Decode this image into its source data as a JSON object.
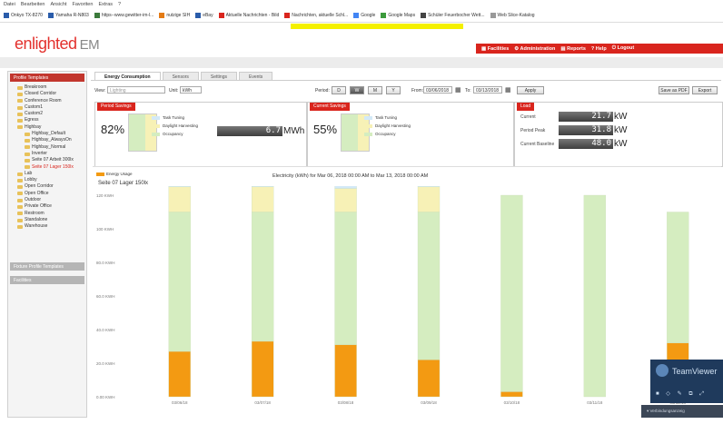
{
  "browser": {
    "menu": [
      "Datei",
      "Bearbeiten",
      "Ansicht",
      "Favoriten",
      "Extras",
      "?"
    ],
    "bookmarks": [
      {
        "label": "Onkyo TX-8270",
        "color": "#2a5caa"
      },
      {
        "label": "Yamaha R-N803",
        "color": "#2a5caa"
      },
      {
        "label": "https--www.gewitter-im-l...",
        "color": "#3b7a3b"
      },
      {
        "label": "nutzige SIH",
        "color": "#e47b15"
      },
      {
        "label": "eBay",
        "color": "#2a5caa"
      },
      {
        "label": "Aktuelle Nachrichten - Bild",
        "color": "#d9251d"
      },
      {
        "label": "Nachrichten, aktuelle Schl...",
        "color": "#d9251d"
      },
      {
        "label": "Google",
        "color": "#4285f4"
      },
      {
        "label": "Google Maps",
        "color": "#3b9a3b"
      },
      {
        "label": "Schüler Feuerbocher Wett...",
        "color": "#444444"
      },
      {
        "label": "Web Slice-Katalog",
        "color": "#999999"
      }
    ]
  },
  "app": {
    "logo_brand": "enlighted",
    "logo_suffix": "EM",
    "nav": [
      "Facilities",
      "Administration",
      "Reports",
      "Help",
      "Logout"
    ]
  },
  "sidebar": {
    "header": "Profile Templates",
    "items": [
      {
        "label": "Breakroom",
        "level": 0,
        "selected": false
      },
      {
        "label": "Closed Corridor",
        "level": 0,
        "selected": false
      },
      {
        "label": "Conference Room",
        "level": 0,
        "selected": false
      },
      {
        "label": "Custom1",
        "level": 0,
        "selected": false
      },
      {
        "label": "Custom2",
        "level": 0,
        "selected": false
      },
      {
        "label": "Egress",
        "level": 0,
        "selected": false
      },
      {
        "label": "Highbay",
        "level": 0,
        "selected": false
      },
      {
        "label": "Highbay_Default",
        "level": 1,
        "selected": false
      },
      {
        "label": "Highbay_AlwaysOn",
        "level": 1,
        "selected": false
      },
      {
        "label": "Highbay_Normal",
        "level": 1,
        "selected": false
      },
      {
        "label": "Inverter",
        "level": 1,
        "selected": false
      },
      {
        "label": "Seite 07 Arbeit 300lx",
        "level": 1,
        "selected": false
      },
      {
        "label": "Seite 07 Lager 150lx",
        "level": 1,
        "selected": true
      },
      {
        "label": "Lab",
        "level": 0,
        "selected": false
      },
      {
        "label": "Lobby",
        "level": 0,
        "selected": false
      },
      {
        "label": "Open Corridor",
        "level": 0,
        "selected": false
      },
      {
        "label": "Open Office",
        "level": 0,
        "selected": false
      },
      {
        "label": "Outdoor",
        "level": 0,
        "selected": false
      },
      {
        "label": "Private Office",
        "level": 0,
        "selected": false
      },
      {
        "label": "Restroom",
        "level": 0,
        "selected": false
      },
      {
        "label": "Standalone",
        "level": 0,
        "selected": false
      },
      {
        "label": "Warehouse",
        "level": 0,
        "selected": false
      }
    ],
    "section2": "Fixture Profile Templates",
    "section3": "Facilities"
  },
  "tabs": [
    "Energy Consumption",
    "Sensors",
    "Settings",
    "Events"
  ],
  "controls": {
    "view_label": "View:",
    "view_value": "Lighting",
    "unit_label": "Unit:",
    "unit_value": "kWh",
    "period_label": "Period:",
    "period_buttons": [
      "D",
      "W",
      "M",
      "Y"
    ],
    "period_active": "W",
    "from_label": "From:",
    "from_value": "03/06/2018",
    "to_label": "To:",
    "to_value": "03/13/2018",
    "apply": "Apply",
    "save_pdf": "Save as PDF",
    "export": "Export"
  },
  "period_savings": {
    "header": "Period Savings",
    "percent": "82%",
    "legend": [
      "Task Tuning",
      "Daylight Harvesting",
      "Occupancy"
    ],
    "value": "6.7",
    "unit": "MWh"
  },
  "current_savings": {
    "header": "Current Savings",
    "percent": "55%",
    "legend": [
      "Task Tuning",
      "Daylight Harvesting",
      "Occupancy"
    ]
  },
  "load": {
    "header": "Load",
    "rows": [
      {
        "label": "Current",
        "value": "21.7",
        "unit": "kW"
      },
      {
        "label": "Period Peak",
        "value": "31.8",
        "unit": "kW"
      },
      {
        "label": "Current Baseline",
        "value": "48.0",
        "unit": "kW"
      }
    ]
  },
  "colors": {
    "brand_red": "#d9251d",
    "energy_usage": "#f39a12",
    "occupancy": "#d5edc0",
    "daylight": "#f7f1b6",
    "task_tuning": "#d3e9f7"
  },
  "teamviewer": {
    "title": "TeamViewer",
    "bar": "Verbindungsanzeig"
  },
  "chart_data": {
    "type": "bar",
    "title": "Electricity (kWh) for Mar 06, 2018 00:00 AM to Mar 13, 2018 00:00 AM",
    "subtitle": "Seite 07 Lager 150lx",
    "legend": [
      "Energy Usage"
    ],
    "ylabels": [
      "120 KWH",
      "100 KWH",
      "80.0 KWH",
      "60.0 KWH",
      "40.0 KWH",
      "20.0 KWH",
      "0.00 KWH"
    ],
    "categories": [
      "03/06/18",
      "03/07/18",
      "03/08/18",
      "03/09/18",
      "03/10/18",
      "03/11/18",
      "03/12/18"
    ],
    "ylim": [
      0,
      120
    ],
    "series": [
      {
        "name": "Energy Usage",
        "values": [
          27,
          33,
          31,
          22,
          3,
          0,
          32
        ]
      },
      {
        "name": "Occupancy",
        "values": [
          83,
          77,
          79,
          88,
          117,
          120,
          78
        ]
      },
      {
        "name": "Daylight Harvesting",
        "values": [
          15,
          15,
          14,
          15,
          0,
          0,
          0
        ]
      },
      {
        "name": "Task Tuning",
        "values": [
          14,
          10,
          8,
          8,
          0,
          0,
          0
        ]
      }
    ]
  }
}
